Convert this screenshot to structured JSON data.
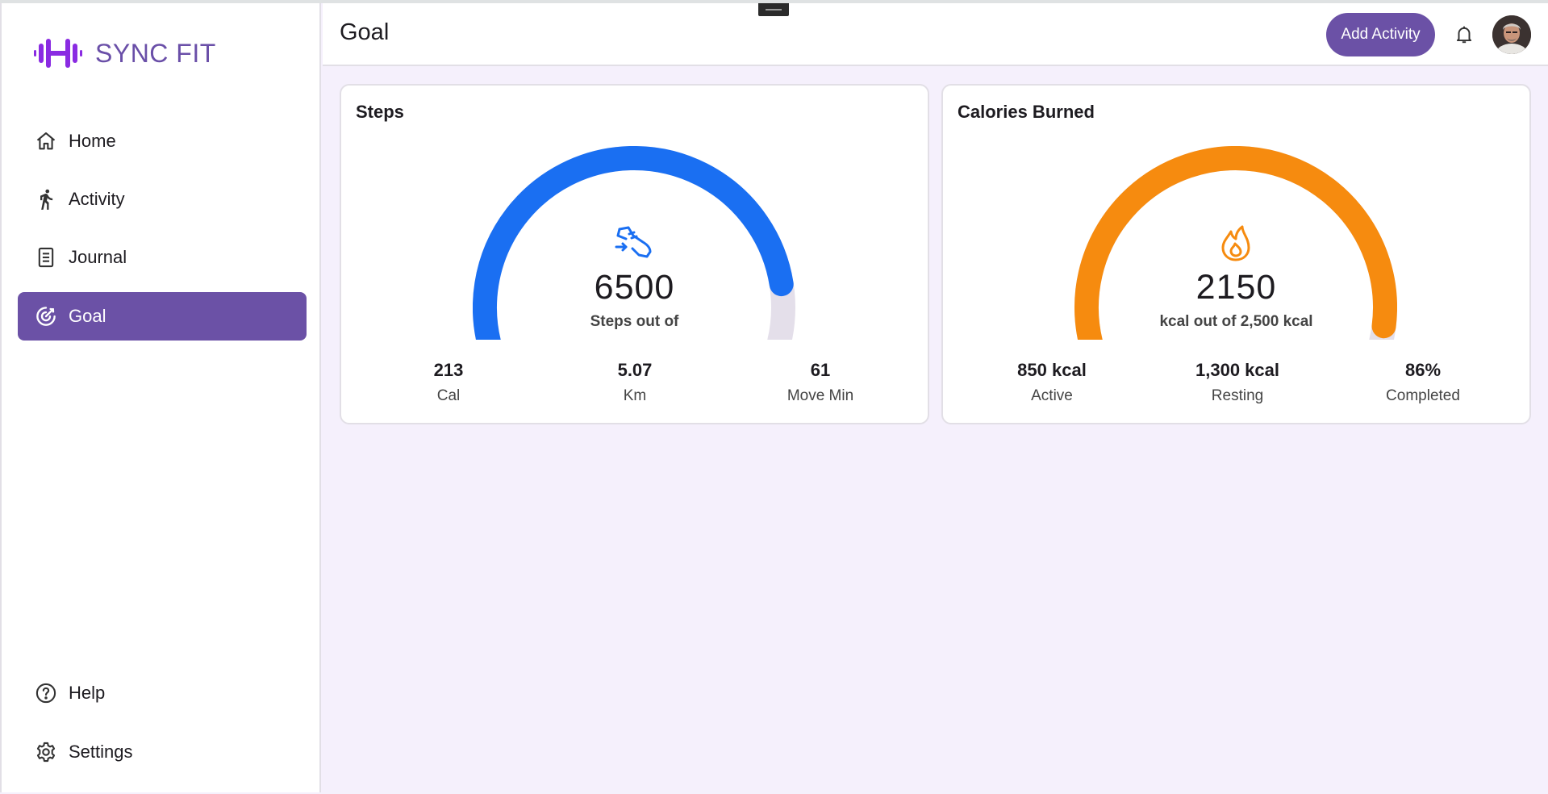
{
  "app": {
    "name": "SYNC FIT",
    "accent": "#6b51a6"
  },
  "sidebar": {
    "items": [
      {
        "label": "Home",
        "icon": "home-icon",
        "active": false
      },
      {
        "label": "Activity",
        "icon": "walk-icon",
        "active": false
      },
      {
        "label": "Journal",
        "icon": "journal-icon",
        "active": false
      },
      {
        "label": "Goal",
        "icon": "goal-icon",
        "active": true
      }
    ],
    "bottom_items": [
      {
        "label": "Help",
        "icon": "help-icon"
      },
      {
        "label": "Settings",
        "icon": "gear-icon"
      }
    ]
  },
  "header": {
    "title": "Goal",
    "add_button_label": "Add Activity",
    "bell_icon": "bell-icon",
    "avatar_icon": "avatar"
  },
  "steps_card": {
    "title": "Steps",
    "icon": "shoe-icon",
    "value": "6500",
    "subtitle": "Steps out of",
    "progress_fraction": 0.8,
    "color": "#1a6ff2",
    "stats": [
      {
        "value": "213",
        "label": "Cal"
      },
      {
        "value": "5.07",
        "label": "Km"
      },
      {
        "value": "61",
        "label": "Move Min"
      }
    ]
  },
  "calories_card": {
    "title": "Calories Burned",
    "icon": "flame-icon",
    "value": "2150",
    "subtitle": "kcal out of 2,500 kcal",
    "progress_fraction": 0.86,
    "color": "#f68b0f",
    "stats": [
      {
        "value": "850 kcal",
        "label": "Active"
      },
      {
        "value": "1,300 kcal",
        "label": "Resting"
      },
      {
        "value": "86%",
        "label": "Completed"
      }
    ]
  },
  "track_color": "#e4dfea"
}
